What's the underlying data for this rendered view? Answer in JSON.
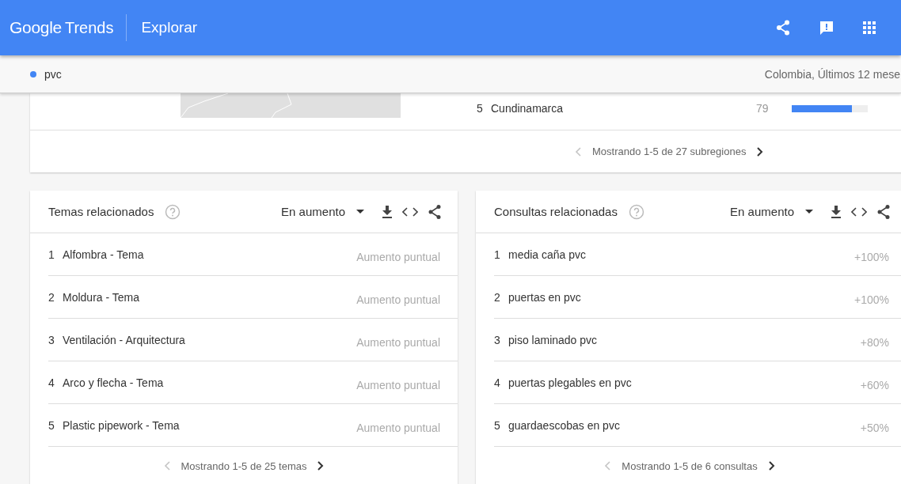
{
  "header": {
    "brand": "Google",
    "product": "Trends",
    "page_title": "Explorar"
  },
  "query_bar": {
    "term": "pvc",
    "color": "#4285f4",
    "scope": "Colombia, Últimos 12 mese"
  },
  "region_card": {
    "rows": [
      {
        "rank": "5",
        "name": "Cundinamarca",
        "value": "79",
        "level": 0.79
      }
    ],
    "pagination": {
      "text": "Mostrando 1-5 de 27 subregiones",
      "prev_disabled": true
    }
  },
  "panels": [
    {
      "title": "Temas relacionados",
      "filter": "En aumento",
      "rows": [
        {
          "rank": "1",
          "name": "Alfombra - Tema",
          "value": "Aumento puntual"
        },
        {
          "rank": "2",
          "name": "Moldura - Tema",
          "value": "Aumento puntual"
        },
        {
          "rank": "3",
          "name": "Ventilación - Arquitectura",
          "value": "Aumento puntual"
        },
        {
          "rank": "4",
          "name": "Arco y flecha - Tema",
          "value": "Aumento puntual"
        },
        {
          "rank": "5",
          "name": "Plastic pipework - Tema",
          "value": "Aumento puntual"
        }
      ],
      "pagination": {
        "text": "Mostrando 1-5 de 25 temas",
        "prev_disabled": true
      }
    },
    {
      "title": "Consultas relacionadas",
      "filter": "En aumento",
      "rows": [
        {
          "rank": "1",
          "name": "media caña pvc",
          "value": "+100%"
        },
        {
          "rank": "2",
          "name": "puertas en pvc",
          "value": "+100%"
        },
        {
          "rank": "3",
          "name": "piso laminado pvc",
          "value": "+80%"
        },
        {
          "rank": "4",
          "name": "puertas plegables en pvc",
          "value": "+60%"
        },
        {
          "rank": "5",
          "name": "guardaescobas en pvc",
          "value": "+50%"
        }
      ],
      "pagination": {
        "text": "Mostrando 1-5 de 6 consultas",
        "prev_disabled": true
      }
    }
  ]
}
